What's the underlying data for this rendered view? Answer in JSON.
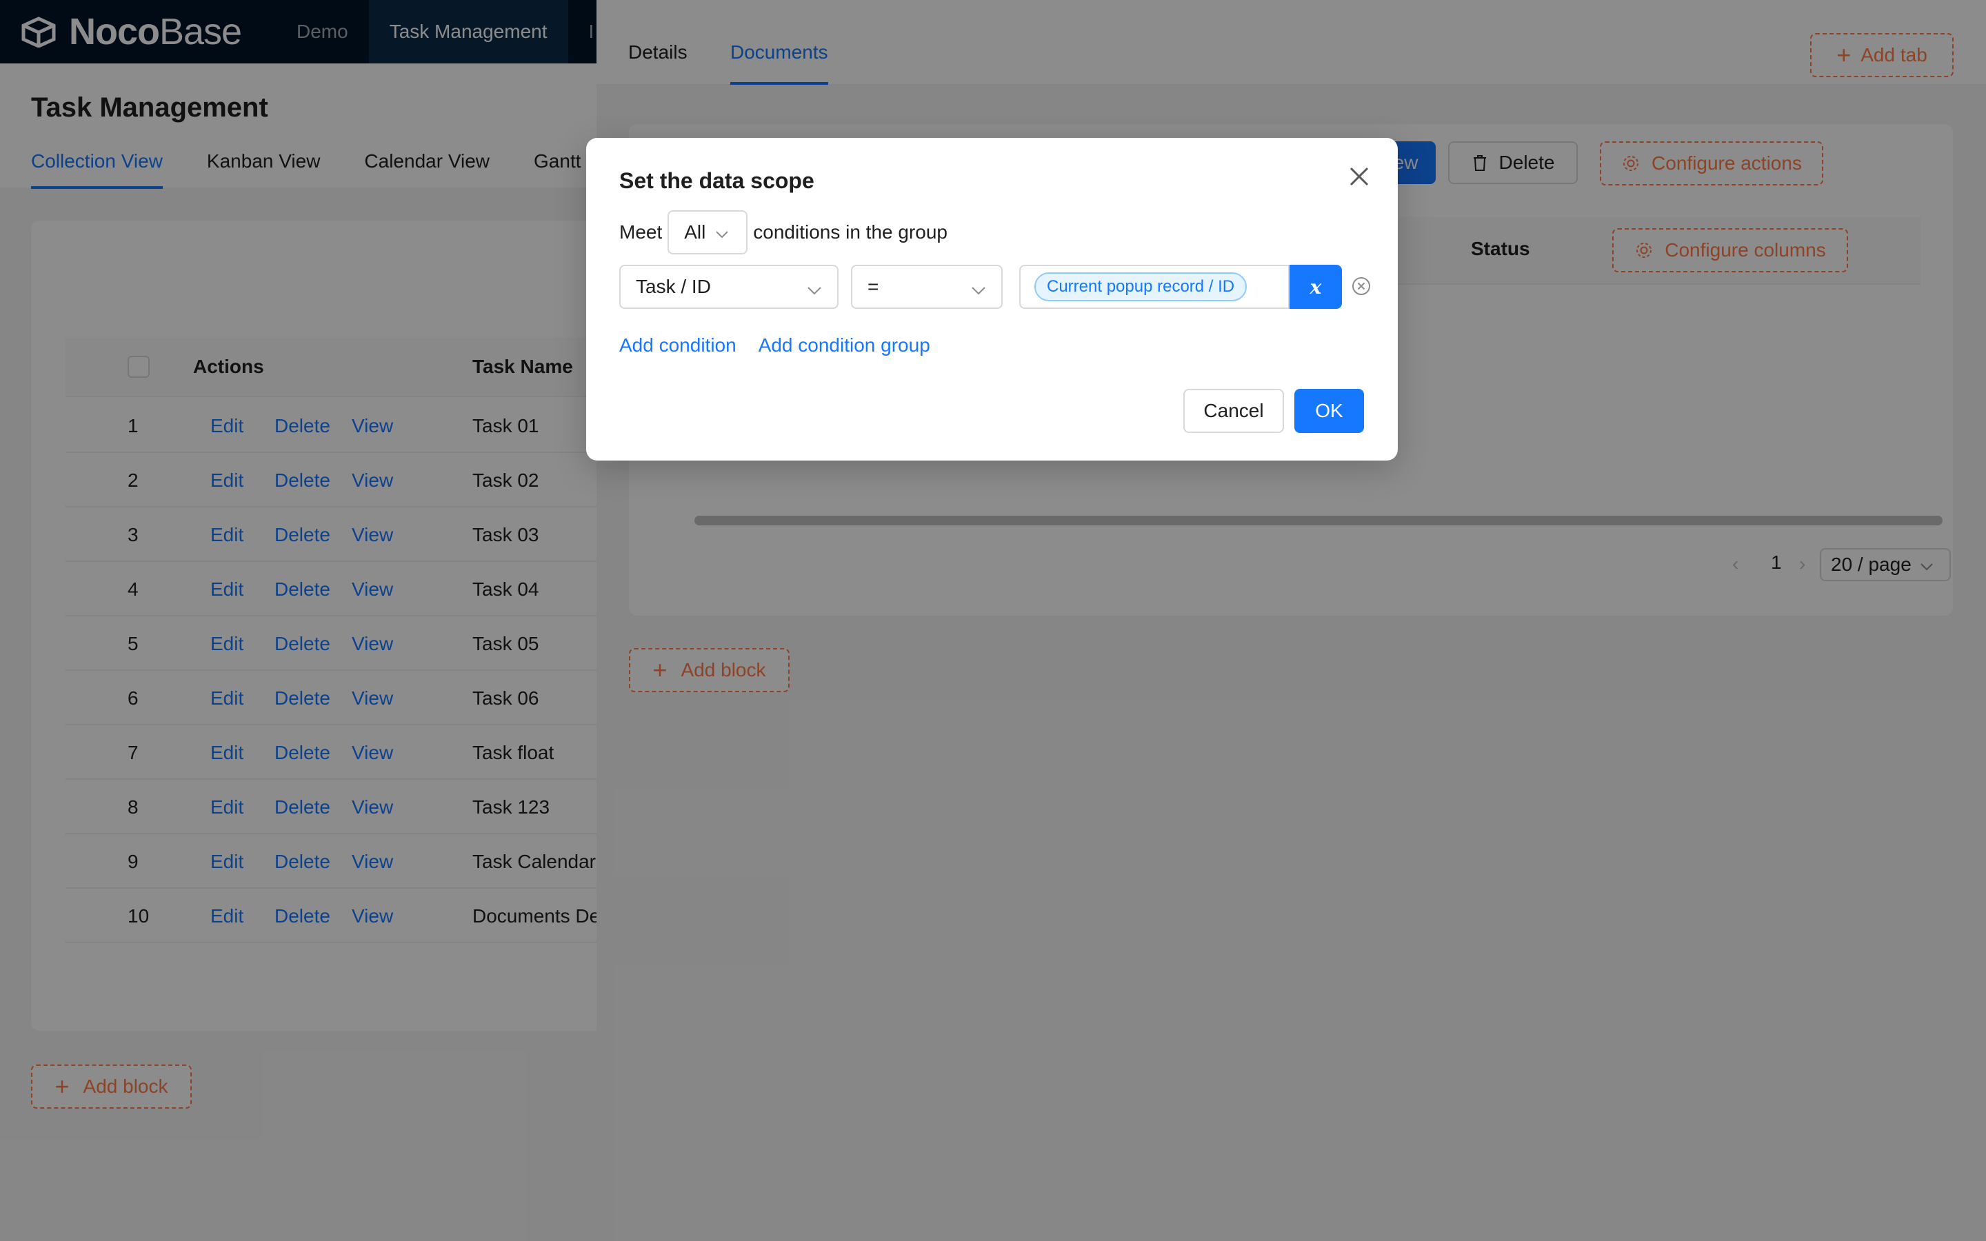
{
  "topbar": {
    "logo_bold": "Noco",
    "logo_light": "Base",
    "nav": [
      "Demo",
      "Task Management",
      "I"
    ]
  },
  "page": {
    "title": "Task Management",
    "tabs": [
      "Collection View",
      "Kanban View",
      "Calendar View",
      "Gantt View"
    ],
    "table": {
      "headers": {
        "actions": "Actions",
        "name": "Task Name"
      },
      "action_labels": {
        "edit": "Edit",
        "delete": "Delete",
        "view": "View"
      },
      "rows": [
        {
          "idx": "1",
          "name": "Task 01"
        },
        {
          "idx": "2",
          "name": "Task 02"
        },
        {
          "idx": "3",
          "name": "Task 03"
        },
        {
          "idx": "4",
          "name": "Task 04"
        },
        {
          "idx": "5",
          "name": "Task 05"
        },
        {
          "idx": "6",
          "name": "Task 06"
        },
        {
          "idx": "7",
          "name": "Task float"
        },
        {
          "idx": "8",
          "name": "Task 123"
        },
        {
          "idx": "9",
          "name": "Task Calendar"
        },
        {
          "idx": "10",
          "name": "Documents Demo"
        }
      ]
    },
    "add_block": "Add block"
  },
  "drawer": {
    "tabs": [
      "Details",
      "Documents"
    ],
    "add_tab": "Add tab",
    "actions": {
      "add_new": "Add new",
      "delete": "Delete",
      "configure_actions": "Configure actions"
    },
    "table": {
      "status_header": "Status",
      "configure_columns": "Configure columns"
    },
    "pagination": {
      "page": "1",
      "page_size": "20 / page"
    },
    "add_block": "Add block"
  },
  "modal": {
    "title": "Set the data scope",
    "meet_prefix": "Meet",
    "meet_value": "All",
    "meet_suffix": "conditions in the group",
    "condition": {
      "field": "Task / ID",
      "operator": "=",
      "value_tag": "Current popup record / ID",
      "variable_button": "x"
    },
    "add_condition": "Add condition",
    "add_condition_group": "Add condition group",
    "cancel": "Cancel",
    "ok": "OK"
  },
  "colors": {
    "primary": "#1677ff",
    "dashed_accent": "#ff7a45",
    "topbar": "#001529"
  },
  "icons": [
    "logo-icon",
    "plus-icon",
    "trash-icon",
    "gear-icon",
    "close-icon",
    "chevron-down-icon",
    "close-circle-icon",
    "chevron-left-icon",
    "chevron-right-icon"
  ]
}
